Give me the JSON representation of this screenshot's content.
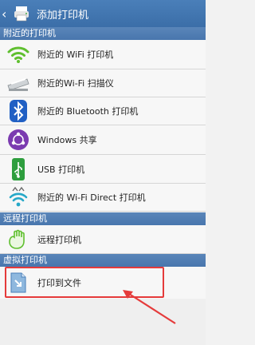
{
  "header": {
    "title": "添加打印机",
    "back_icon": "chevron-left-icon",
    "app_icon": "printer-icon"
  },
  "sections": {
    "nearby": "附近的打印机",
    "remote": "远程打印机",
    "virtual": "虚拟打印机"
  },
  "nearby_items": [
    {
      "label": "附近的 WiFi 打印机",
      "icon": "wifi-icon"
    },
    {
      "label": "附近的Wi-Fi 扫描仪",
      "icon": "scanner-icon"
    },
    {
      "label": "附近的 Bluetooth 打印机",
      "icon": "bluetooth-icon"
    },
    {
      "label": "Windows 共享",
      "icon": "share-icon"
    },
    {
      "label": "USB 打印机",
      "icon": "usb-icon"
    },
    {
      "label": "附近的 Wi-Fi Direct 打印机",
      "icon": "wifi-direct-icon"
    }
  ],
  "remote_items": [
    {
      "label": "远程打印机",
      "icon": "hand-icon"
    }
  ],
  "virtual_items": [
    {
      "label": "打印到文件",
      "icon": "file-icon"
    }
  ],
  "colors": {
    "header": "#3b6ea8",
    "highlight": "#e53b3b",
    "wifi": "#5fbf2f"
  }
}
